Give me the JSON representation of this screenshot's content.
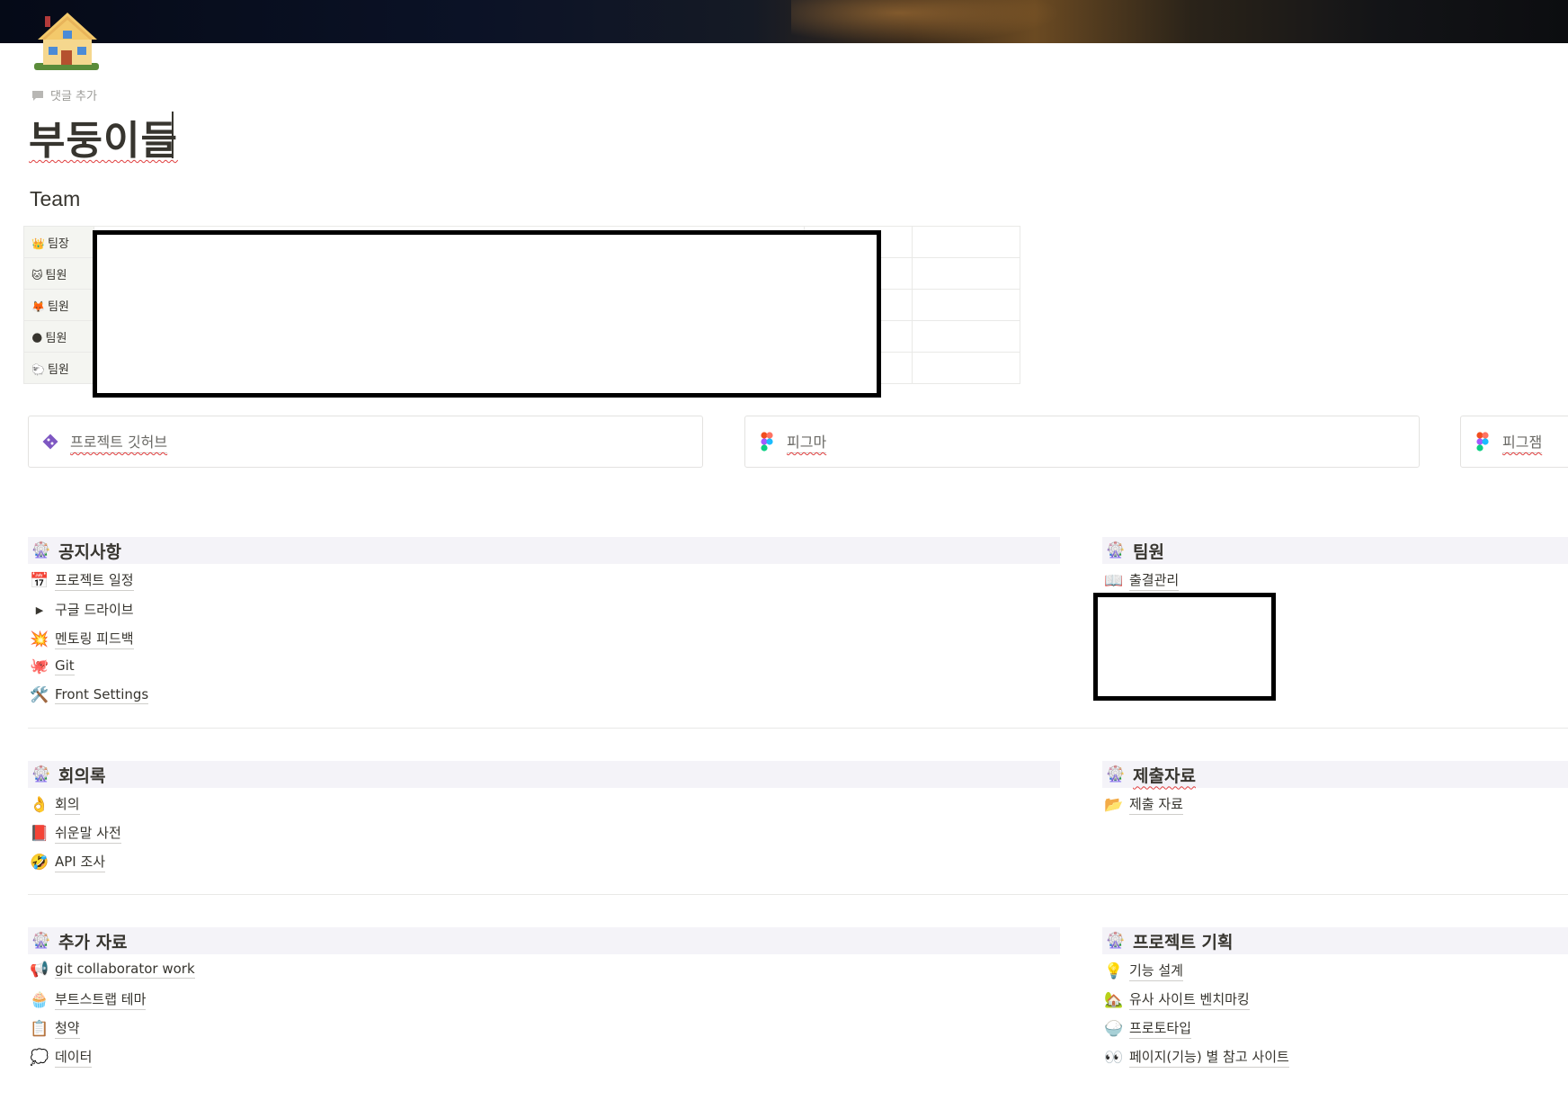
{
  "page": {
    "icon": "house-icon",
    "add_comment": "댓글 추가",
    "title": "부둥이들"
  },
  "team": {
    "heading": "Team",
    "rows": [
      {
        "emoji": "👑",
        "role": "팀장"
      },
      {
        "emoji": "🐱",
        "role": "팀원"
      },
      {
        "emoji": "🦊",
        "role": "팀원"
      },
      {
        "emoji": "🌑",
        "role": "팀원"
      },
      {
        "emoji": "🐑",
        "role": "팀원"
      }
    ]
  },
  "links": [
    {
      "label": "프로젝트 깃허브",
      "icon": "git-icon"
    },
    {
      "label": "피그마",
      "icon": "figma-icon"
    },
    {
      "label": "피그잼",
      "icon": "figma-icon"
    }
  ],
  "sections": {
    "notice": {
      "title": "공지사항",
      "items": [
        {
          "emoji": "📅",
          "label": "프로젝트 일정"
        },
        {
          "emoji": "▶",
          "label": "구글 드라이브"
        },
        {
          "emoji": "💥",
          "label": "멘토링 피드백"
        },
        {
          "emoji": "🐙",
          "label": "Git"
        },
        {
          "emoji": "🛠️",
          "label": "Front Settings"
        }
      ]
    },
    "members": {
      "title": "팀원",
      "items": [
        {
          "emoji": "📖",
          "label": "출결관리"
        }
      ]
    },
    "minutes": {
      "title": "회의록",
      "items": [
        {
          "emoji": "👌",
          "label": "회의"
        },
        {
          "emoji": "📕",
          "label": "쉬운말 사전"
        },
        {
          "emoji": "🤣",
          "label": "API 조사"
        }
      ]
    },
    "submissions": {
      "title": "제출자료",
      "items": [
        {
          "emoji": "📂",
          "label": "제출 자료"
        }
      ]
    },
    "extra": {
      "title": "추가 자료",
      "items": [
        {
          "emoji": "📢",
          "label": "git collaborator work"
        },
        {
          "emoji": "🧁",
          "label": "부트스트랩 테마"
        },
        {
          "emoji": "📋",
          "label": "청약"
        },
        {
          "emoji": "💭",
          "label": "데이터"
        }
      ]
    },
    "planning": {
      "title": "프로젝트 기획",
      "items": [
        {
          "emoji": "💡",
          "label": "기능 설계"
        },
        {
          "emoji": "🏡",
          "label": "유사 사이트 벤치마킹"
        },
        {
          "emoji": "🍚",
          "label": "프로토타입"
        },
        {
          "emoji": "👀",
          "label": "페이지(기능) 별 참고 사이트"
        }
      ]
    },
    "section_icon": "ferris-wheel-icon"
  }
}
